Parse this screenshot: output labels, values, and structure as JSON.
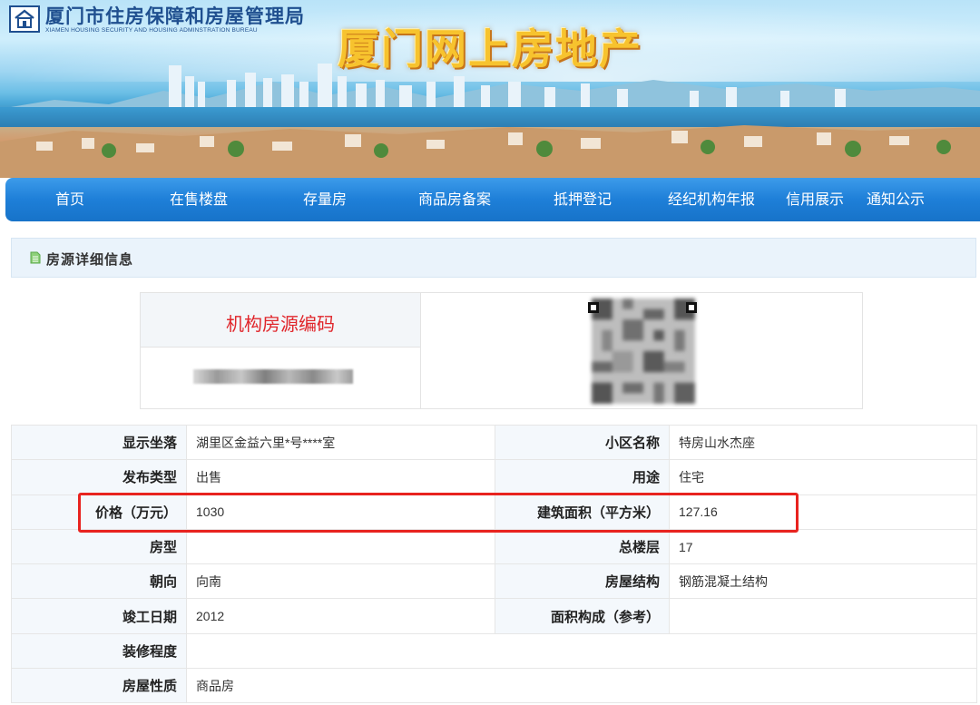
{
  "header": {
    "org_name": "厦门市住房保障和房屋管理局",
    "org_name_en": "XIAMEN HOUSING SECURITY AND HOUSING ADMINSTRATION BUREAU",
    "site_title": "厦门网上房地产",
    "logo_icon": "house-emblem-icon"
  },
  "nav": {
    "items": [
      {
        "label": "首页"
      },
      {
        "label": "在售楼盘"
      },
      {
        "label": "存量房"
      },
      {
        "label": "商品房备案"
      },
      {
        "label": "抵押登记"
      },
      {
        "label": "经纪机构年报"
      },
      {
        "label": "信用展示"
      },
      {
        "label": "通知公示"
      }
    ]
  },
  "section": {
    "title": "房源详细信息",
    "icon": "document-icon"
  },
  "listing_code": {
    "label": "机构房源编码",
    "value_redacted": true,
    "qr_code_redacted": true
  },
  "details": {
    "rows": [
      {
        "l1": "显示坐落",
        "v1": "湖里区金益六里*号****室",
        "l2": "小区名称",
        "v2": "特房山水杰座"
      },
      {
        "l1": "发布类型",
        "v1": "出售",
        "l2": "用途",
        "v2": "住宅"
      },
      {
        "l1": "价格（万元）",
        "v1": "1030",
        "l2": "建筑面积（平方米）",
        "v2": "127.16"
      },
      {
        "l1": "房型",
        "v1": "",
        "l2": "总楼层",
        "v2": "17"
      },
      {
        "l1": "朝向",
        "v1": "向南",
        "l2": "房屋结构",
        "v2": "钢筋混凝土结构"
      },
      {
        "l1": "竣工日期",
        "v1": "2012",
        "l2": "面积构成（参考）",
        "v2": ""
      },
      {
        "l1": "装修程度",
        "v1": ""
      },
      {
        "l1": "房屋性质",
        "v1": "商品房"
      }
    ]
  },
  "colors": {
    "nav_blue": "#1e7fd8",
    "highlight_red": "#e8231f",
    "code_label_red": "#e0262b",
    "title_gold": "#f7c32e"
  }
}
